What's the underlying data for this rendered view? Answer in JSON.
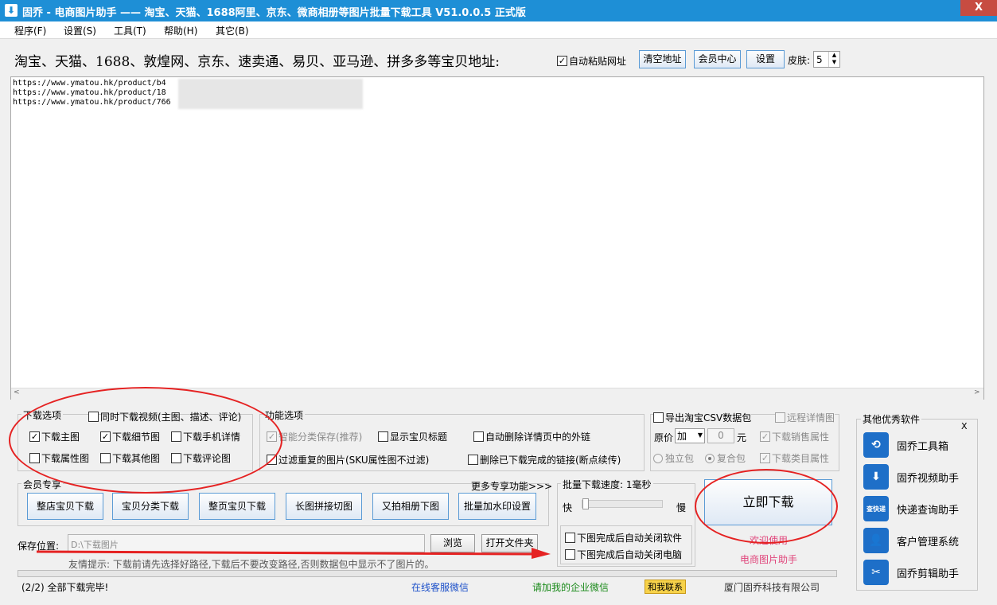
{
  "window": {
    "title": "固乔 - 电商图片助手 —— 淘宝、天猫、1688阿里、京东、微商相册等图片批量下载工具 V51.0.0.5 正式版",
    "close": "X"
  },
  "menu": [
    "程序(F)",
    "设置(S)",
    "工具(T)",
    "帮助(H)",
    "其它(B)"
  ],
  "address_row": {
    "label": "淘宝、天猫、1688、敦煌网、京东、速卖通、易贝、亚马逊、拼多多等宝贝地址:",
    "auto_paste": "自动粘贴网址",
    "clear_btn": "清空地址",
    "member_btn": "会员中心",
    "settings_btn": "设置",
    "skin_label": "皮肤:",
    "skin_value": "5"
  },
  "urls": [
    "https://www.ymatou.hk/product/b4",
    "https://www.ymatou.hk/product/18",
    "https://www.ymatou.hk/product/766"
  ],
  "download_options": {
    "title": "下载选项",
    "video": "同时下载视频(主图、描述、评论)",
    "main_img": "下载主图",
    "detail_img": "下载细节图",
    "mobile_detail": "下载手机详情",
    "attr_img": "下载属性图",
    "other_img": "下载其他图",
    "review_img": "下载评论图"
  },
  "function_options": {
    "title": "功能选项",
    "smart_save": "智能分类保存(推荐)",
    "show_title": "显示宝贝标题",
    "auto_remove_links": "自动删除详情页中的外链",
    "filter_dup": "过滤重复的图片(SKU属性图不过滤)",
    "delete_done": "删除已下载完成的链接(断点续传)"
  },
  "csv": {
    "export": "导出淘宝CSV数据包",
    "remote_detail": "远程详情图",
    "price_label": "原价",
    "price_op": "加",
    "price_value": "0",
    "unit": "元",
    "sales_attr": "下载销售属性",
    "single_pack": "独立包",
    "combined_pack": "复合包",
    "category_attr": "下载类目属性"
  },
  "member": {
    "title": "会员专享",
    "more": "更多专享功能>>>",
    "buttons": [
      "整店宝贝下载",
      "宝贝分类下载",
      "整页宝贝下载",
      "长图拼接切图",
      "又拍相册下图",
      "批量加水印设置"
    ]
  },
  "speed": {
    "title": "批量下载速度: 1毫秒",
    "fast": "快",
    "slow": "慢",
    "slider_value": 0,
    "close_app": "下图完成后自动关闭软件",
    "shutdown_pc": "下图完成后自动关闭电脑"
  },
  "download_now": "立即下载",
  "welcome": "欢迎使用",
  "product_name": "电商图片助手",
  "save": {
    "label": "保存位置:",
    "path": "D:\\下载图片",
    "browse": "浏览",
    "open_folder": "打开文件夹",
    "tip": "友情提示: 下载前请先选择好路径,下载后不要改变路径,否则数据包中显示不了图片的。"
  },
  "other_software": {
    "title": "其他优秀软件",
    "close": "X",
    "items": [
      {
        "name": "固乔工具箱",
        "icon": "toolbox-icon",
        "glyph": "⟲"
      },
      {
        "name": "固乔视频助手",
        "icon": "video-download-icon",
        "glyph": "⬇"
      },
      {
        "name": "快递查询助手",
        "icon": "express-query-icon",
        "glyph": "查快递"
      },
      {
        "name": "客户管理系统",
        "icon": "customer-icon",
        "glyph": "👤"
      },
      {
        "name": "固乔剪辑助手",
        "icon": "scissors-icon",
        "glyph": "✂"
      }
    ]
  },
  "status": {
    "progress": "(2/2) 全部下载完毕!",
    "online_service": "在线客服微信",
    "wechat": "请加我的企业微信",
    "contact": "和我联系",
    "company": "厦门固乔科技有限公司"
  },
  "colors": {
    "titlebar": "#1e8fd6",
    "highlight_red": "#e52222",
    "pink": "#e0447a",
    "link_blue": "#1b4fc9",
    "link_green": "#1a8a1a"
  }
}
